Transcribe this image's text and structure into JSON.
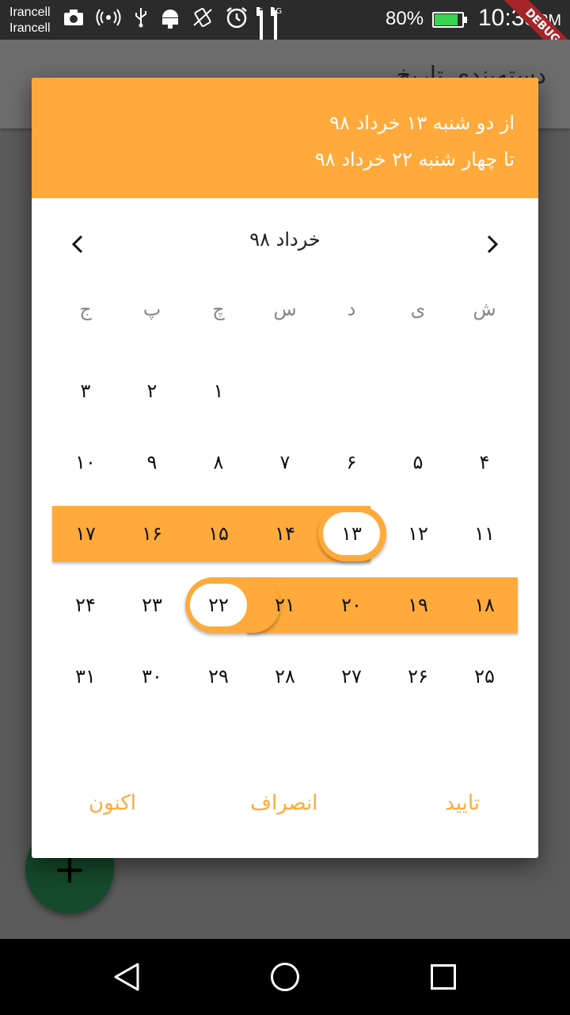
{
  "status_bar": {
    "carrier_line1": "Irancell",
    "carrier_line2": "Irancell",
    "battery_pct": "80%",
    "time": "10:35",
    "time_suffix": "PM",
    "debug_banner": "DEBUG",
    "signal1_tag": "G",
    "signal2_tag": "4G"
  },
  "app_bar": {
    "title_partial": "دسته‌بندی تاریخ"
  },
  "fab": {
    "label": "+"
  },
  "dialog": {
    "header": {
      "from": "از دو شنبه ۱۳ خرداد ۹۸",
      "to": "تا چهار شنبه ۲۲ خرداد ۹۸"
    },
    "month_label": "خرداد ۹۸",
    "prev_icon": "‹",
    "next_icon": "›",
    "weekdays": [
      "ش",
      "ی",
      "د",
      "س",
      "چ",
      "پ",
      "ج"
    ],
    "weeks": [
      [
        "",
        "",
        "",
        "",
        "۱",
        "۲",
        "۳"
      ],
      [
        "۴",
        "۵",
        "۶",
        "۷",
        "۸",
        "۹",
        "۱۰"
      ],
      [
        "۱۱",
        "۱۲",
        "۱۳",
        "۱۴",
        "۱۵",
        "۱۶",
        "۱۷"
      ],
      [
        "۱۸",
        "۱۹",
        "۲۰",
        "۲۱",
        "۲۲",
        "۲۳",
        "۲۴"
      ],
      [
        "۲۵",
        "۲۶",
        "۲۷",
        "۲۸",
        "۲۹",
        "۳۰",
        "۳۱"
      ]
    ],
    "range_start": "۱۳",
    "range_end": "۲۲",
    "actions": {
      "confirm": "تایید",
      "cancel": "انصراف",
      "now": "اکنون"
    }
  },
  "colors": {
    "accent": "#ffaa3a",
    "debug": "#a3252a",
    "fab": "#154a2c"
  }
}
